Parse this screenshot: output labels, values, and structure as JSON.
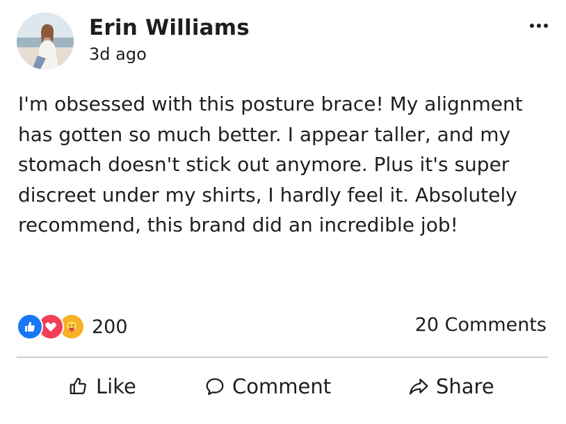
{
  "post": {
    "author": "Erin Williams",
    "time": "3d ago",
    "text": "I'm obsessed with this posture brace! My alignment has gotten so much better. I appear taller, and my stomach doesn't stick out anymore. Plus it's super discreet under my shirts, I hardly feel it. Absolutely recommend, this brand did an incredible job!",
    "more_icon": "more-horizontal-icon"
  },
  "reactions": {
    "types": [
      "like",
      "love",
      "care"
    ],
    "count": "200",
    "colors": {
      "like": "#1877f2",
      "love": "#f33e58",
      "care": "#f7b125"
    }
  },
  "comments_count": "20 Comments",
  "actions": {
    "like": "Like",
    "comment": "Comment",
    "share": "Share"
  },
  "colors": {
    "text": "#1c1e21",
    "divider": "#c6cdd6"
  }
}
